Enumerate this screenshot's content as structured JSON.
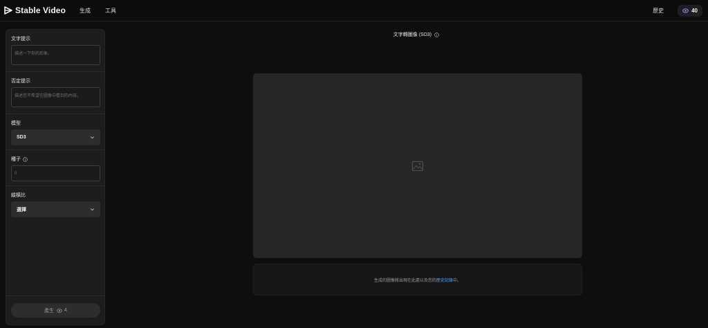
{
  "header": {
    "brand_name": "Stable Video",
    "brand_icon": "play-logo-icon",
    "nav": [
      {
        "label": "生成"
      },
      {
        "label": "工具"
      }
    ],
    "history_label": "歷史",
    "credits_icon": "eye-coin-icon",
    "credits_value": "40",
    "accent_color": "#5aa3e8"
  },
  "sidebar": {
    "prompt": {
      "title": "文字提示",
      "placeholder": "描述一下你的形象。"
    },
    "negative_prompt": {
      "title": "否定提示",
      "placeholder": "描述您不希望在圖像中看到的內容。"
    },
    "model": {
      "title": "模型",
      "value": "SD3"
    },
    "seed": {
      "title": "種子",
      "placeholder": "0"
    },
    "aspect_ratio": {
      "title": "縱橫比",
      "value": "選擇"
    },
    "generate": {
      "label": "產生",
      "cost": "4"
    }
  },
  "main": {
    "title": "文字轉圖像 (SD3)",
    "notice_text": "生成的圖像將出現在此處以及您的",
    "notice_link": "歷史記錄",
    "notice_suffix": "中。"
  }
}
